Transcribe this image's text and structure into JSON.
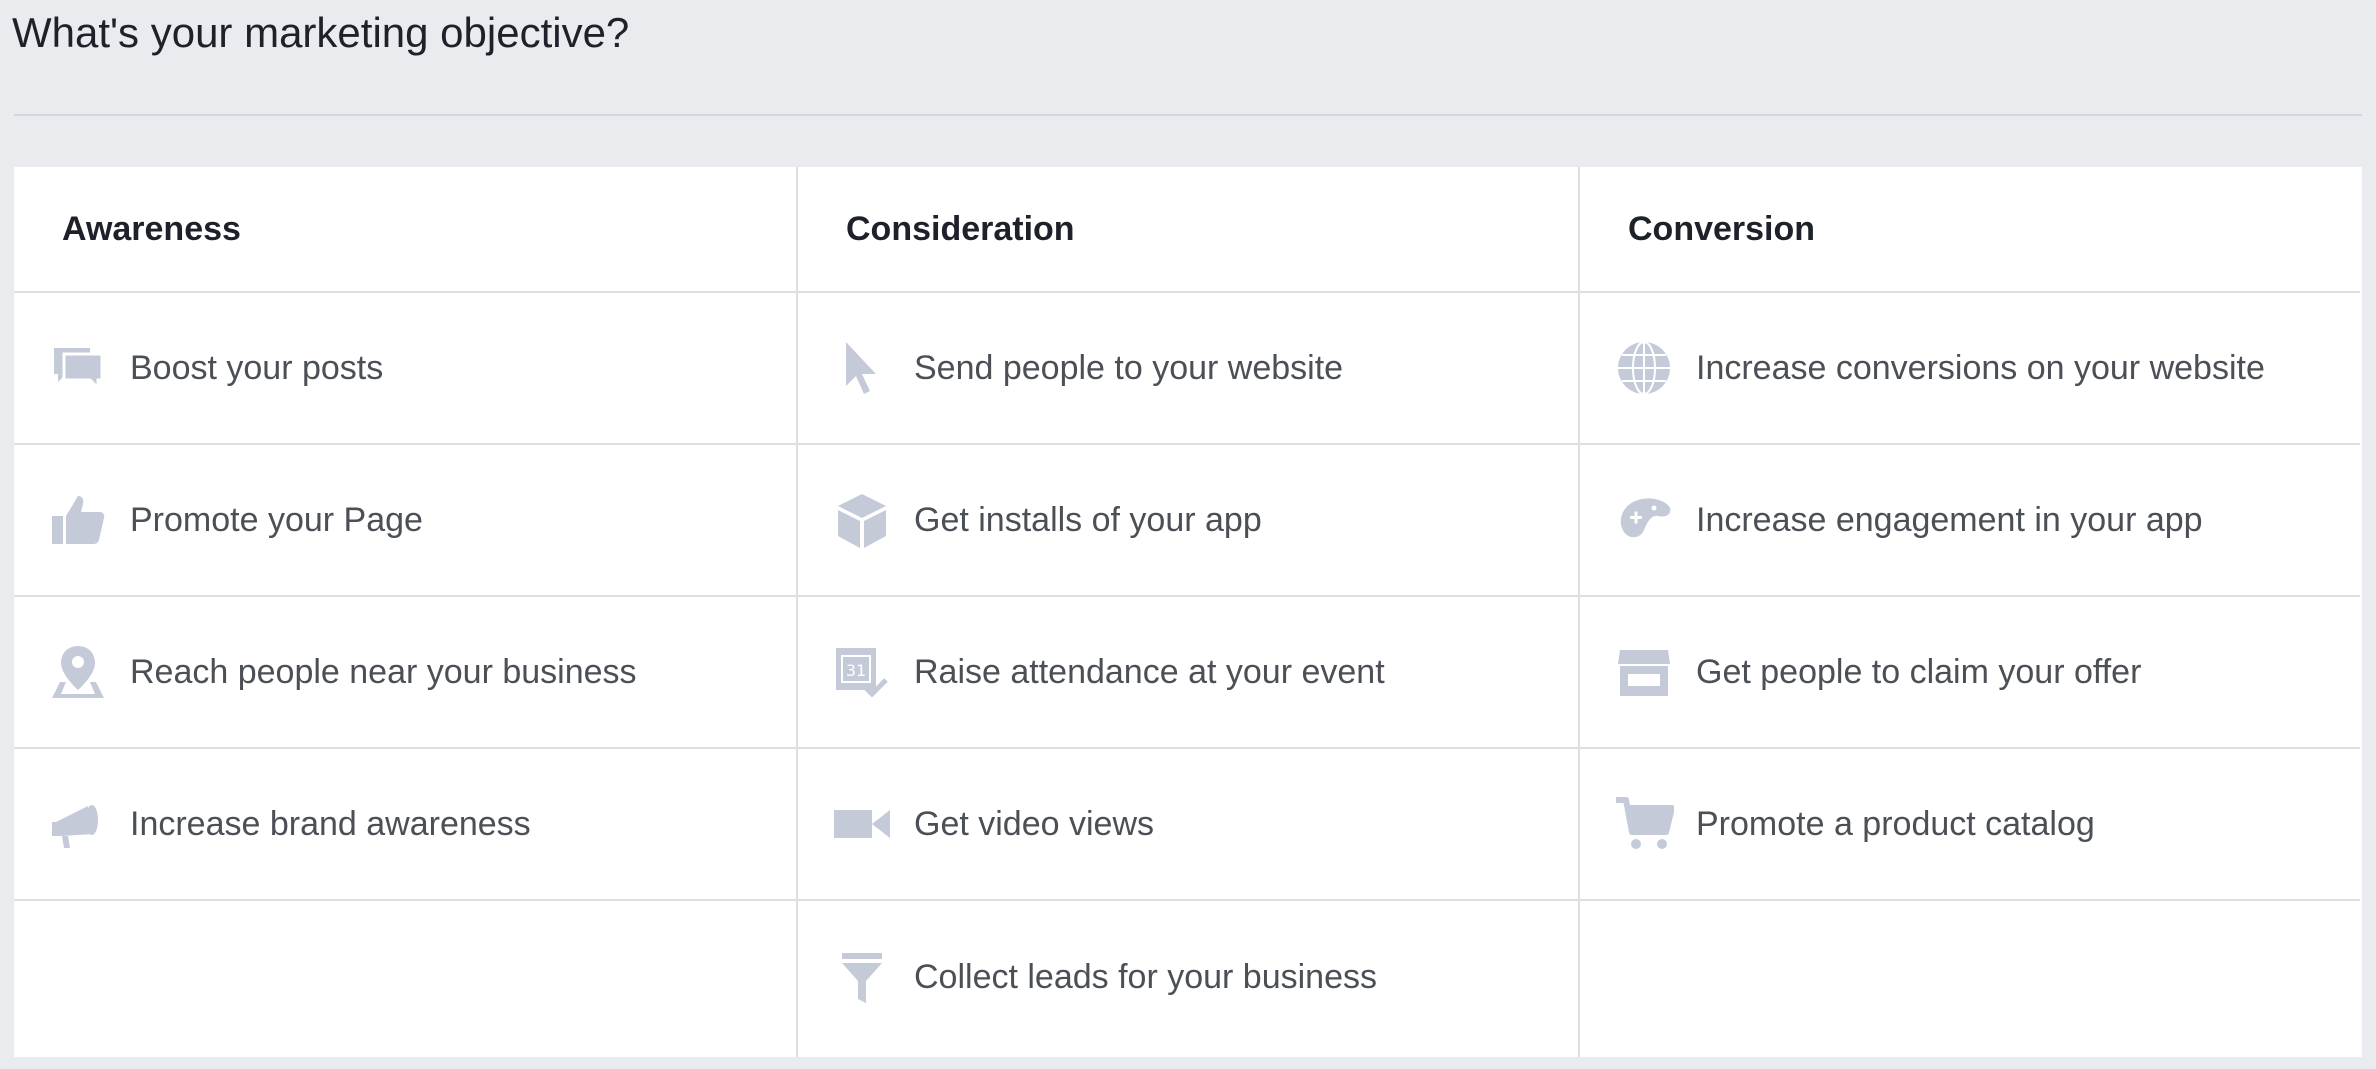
{
  "page": {
    "title": "What's your marketing objective?"
  },
  "colors": {
    "background": "#e9ebee",
    "icon": "#c4cad8",
    "text": "#4b4f56",
    "heading": "#1d2129"
  },
  "columns": [
    {
      "header": "Awareness",
      "items": [
        {
          "label": "Boost your posts",
          "icon": "comments-icon"
        },
        {
          "label": "Promote your Page",
          "icon": "thumbs-up-icon"
        },
        {
          "label": "Reach people near your business",
          "icon": "map-pin-icon"
        },
        {
          "label": "Increase brand awareness",
          "icon": "megaphone-icon"
        }
      ]
    },
    {
      "header": "Consideration",
      "items": [
        {
          "label": "Send people to your website",
          "icon": "cursor-icon"
        },
        {
          "label": "Get installs of your app",
          "icon": "box-icon"
        },
        {
          "label": "Raise attendance at your event",
          "icon": "calendar-icon"
        },
        {
          "label": "Get video views",
          "icon": "video-camera-icon"
        },
        {
          "label": "Collect leads for your business",
          "icon": "funnel-icon"
        }
      ]
    },
    {
      "header": "Conversion",
      "items": [
        {
          "label": "Increase conversions on your website",
          "icon": "globe-icon"
        },
        {
          "label": "Increase engagement in your app",
          "icon": "game-controller-icon"
        },
        {
          "label": "Get people to claim your offer",
          "icon": "storefront-icon"
        },
        {
          "label": "Promote a product catalog",
          "icon": "shopping-cart-icon"
        }
      ]
    }
  ]
}
